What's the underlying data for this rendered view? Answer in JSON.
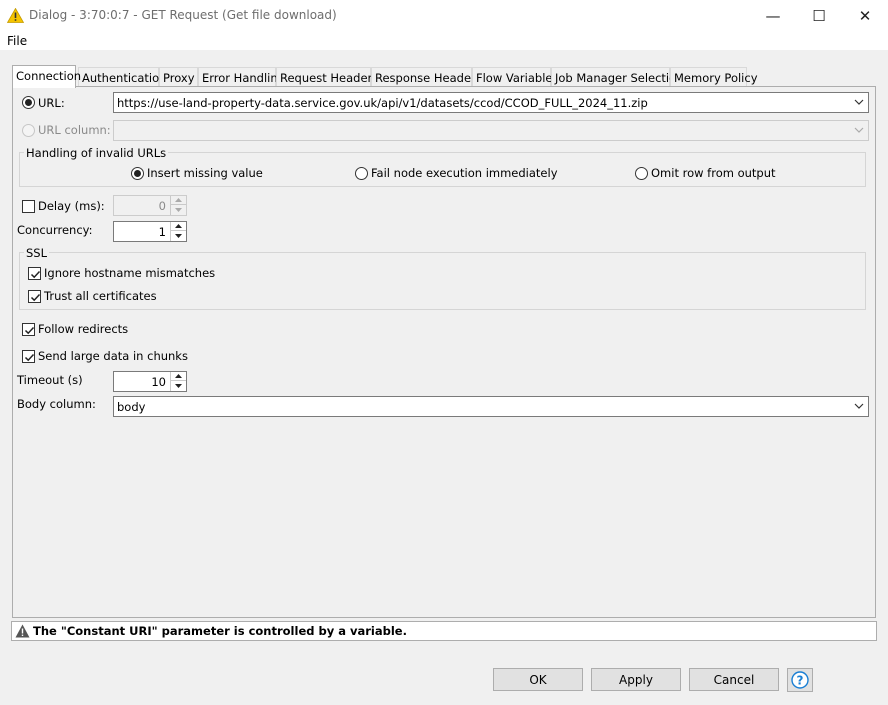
{
  "window": {
    "title": "Dialog - 3:70:0:7 - GET Request (Get file download)",
    "minimize_glyph": "—",
    "maximize_glyph": "☐",
    "close_glyph": "✕"
  },
  "menu": {
    "file": "File"
  },
  "tabs": [
    {
      "label": "Connection",
      "active": true
    },
    {
      "label": "Authentication"
    },
    {
      "label": "Proxy"
    },
    {
      "label": "Error Handling"
    },
    {
      "label": "Request Headers"
    },
    {
      "label": "Response Headers"
    },
    {
      "label": "Flow Variables"
    },
    {
      "label": "Job Manager Selection"
    },
    {
      "label": "Memory Policy"
    }
  ],
  "connection": {
    "url_label": "URL:",
    "url_value": "https://use-land-property-data.service.gov.uk/api/v1/datasets/ccod/CCOD_FULL_2024_11.zip",
    "url_column_label": "URL column:",
    "url_column_value": "",
    "invalid_urls": {
      "title": "Handling of invalid URLs",
      "options": [
        "Insert missing value",
        "Fail node execution immediately",
        "Omit row from output"
      ],
      "selected": "Insert missing value"
    },
    "delay_label": "Delay (ms):",
    "delay_checked": false,
    "delay_value": "0",
    "concurrency_label": "Concurrency:",
    "concurrency_value": "1",
    "ssl": {
      "title": "SSL",
      "ignore_hostname": "Ignore hostname mismatches",
      "ignore_hostname_checked": true,
      "trust_all": "Trust all certificates",
      "trust_all_checked": true
    },
    "follow_redirects": "Follow redirects",
    "follow_redirects_checked": true,
    "send_chunks": "Send large data in chunks",
    "send_chunks_checked": true,
    "timeout_label": "Timeout (s)",
    "timeout_value": "10",
    "body_column_label": "Body column:",
    "body_column_value": "body"
  },
  "status": {
    "message": "The \"Constant URI\" parameter is controlled by a variable."
  },
  "buttons": {
    "ok": "OK",
    "apply": "Apply",
    "cancel": "Cancel"
  },
  "colors": {
    "warning_yellow": "#f5c400",
    "help_blue": "#1a7fd4"
  }
}
